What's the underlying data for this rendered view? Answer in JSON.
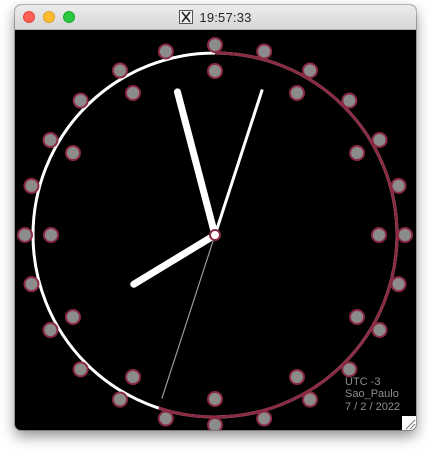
{
  "window": {
    "title": "19:57:33",
    "title_icon": "x11-icon",
    "buttons": [
      "close",
      "minimize",
      "zoom"
    ]
  },
  "clock": {
    "time": {
      "hours": 19,
      "minutes": 57,
      "seconds": 33
    },
    "timezone_label": "UTC -3",
    "city_label": "Sao_Paulo",
    "date_label": "7 / 2 / 2022",
    "colors": {
      "background": "#000000",
      "ring_elapsed": "#8b2a43",
      "ring_remaining": "#ffffff",
      "dot_fill": "#8c8c8c",
      "dot_stroke": "#8b2a43",
      "hands": "#ffffff",
      "second_hand": "#9a9a9a",
      "info_text": "#8e8e8e"
    }
  }
}
